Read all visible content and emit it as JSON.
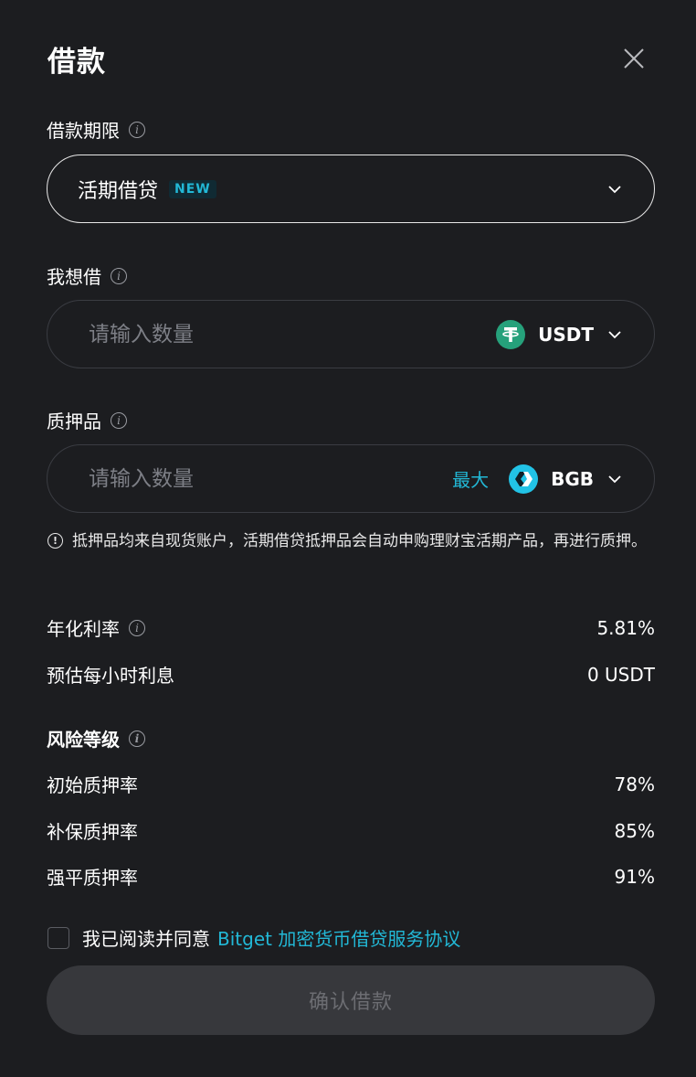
{
  "dialog": {
    "title": "借款"
  },
  "term": {
    "label": "借款期限",
    "selected": "活期借贷",
    "badge": "NEW"
  },
  "borrow": {
    "label": "我想借",
    "placeholder": "请输入数量",
    "asset": "USDT",
    "asset_icon": "tether-icon",
    "asset_color": "#26a17b"
  },
  "collateral": {
    "label": "质押品",
    "placeholder": "请输入数量",
    "max_label": "最大",
    "asset": "BGB",
    "asset_icon": "bitget-icon",
    "asset_color": "#22c3e6"
  },
  "notice": "抵押品均来自现货账户，活期借贷抵押品会自动申购理财宝活期产品，再进行质押。",
  "rates": {
    "annual_label": "年化利率",
    "annual_value": "5.81%",
    "hourly_label": "预估每小时利息",
    "hourly_value": "0 USDT"
  },
  "risk": {
    "title": "风险等级",
    "items": [
      {
        "label": "初始质押率",
        "value": "78%"
      },
      {
        "label": "补保质押率",
        "value": "85%"
      },
      {
        "label": "强平质押率",
        "value": "91%"
      }
    ]
  },
  "agreement": {
    "text": "我已阅读并同意",
    "link": "Bitget 加密货币借贷服务协议"
  },
  "confirm_label": "确认借款",
  "colors": {
    "background": "#1c1d20",
    "accent": "#22b8d6",
    "button_disabled": "#37383c"
  }
}
